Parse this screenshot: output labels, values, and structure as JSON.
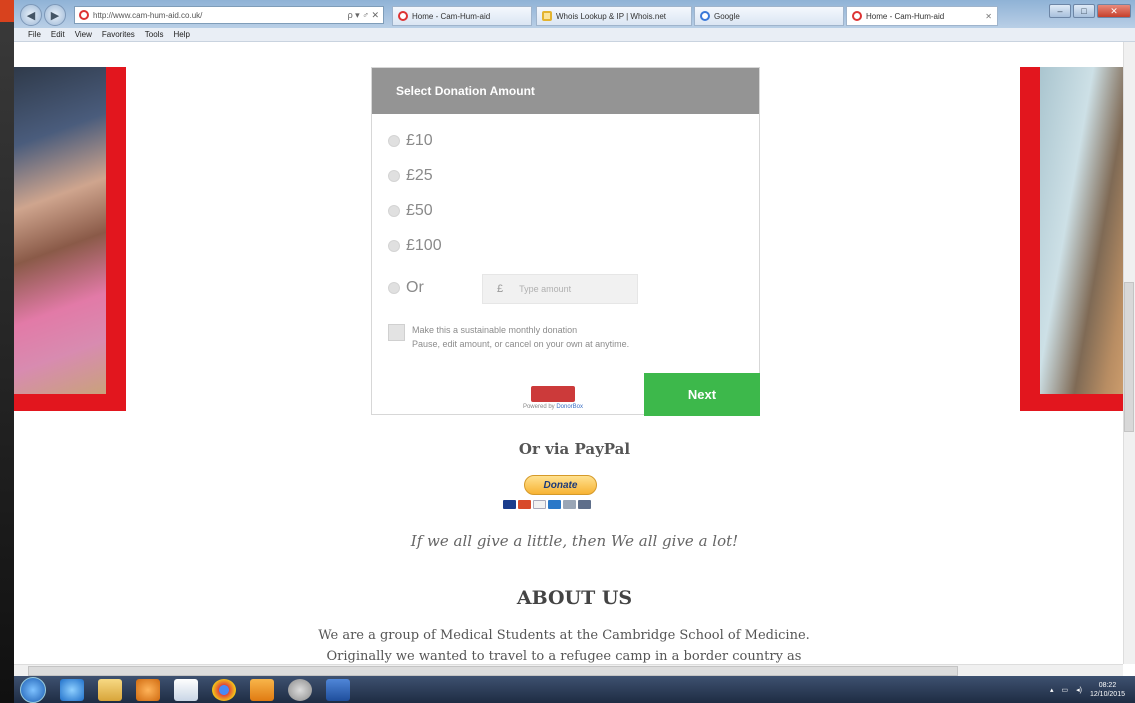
{
  "browser": {
    "address": "http://www.cam-hum-aid.co.uk/",
    "address_controls": "ρ ▾ ♂ ✕",
    "tabs": [
      {
        "label": "Home - Cam-Hum-aid"
      },
      {
        "label": "Whois Lookup & IP | Whois.net"
      },
      {
        "label": "Google"
      },
      {
        "label": "Home - Cam-Hum-aid"
      }
    ],
    "menu": [
      "File",
      "Edit",
      "View",
      "Favorites",
      "Tools",
      "Help"
    ]
  },
  "donation": {
    "header": "Select Donation Amount",
    "amounts": [
      "£10",
      "£25",
      "£50",
      "£100"
    ],
    "or_label": "Or",
    "currency_symbol": "£",
    "custom_placeholder": "Type amount",
    "monthly_line1": "Make this a sustainable monthly donation",
    "monthly_line2": "Pause, edit amount, or cancel on your own at anytime.",
    "powered_by": "Powered by",
    "powered_by_brand": "DonorBox",
    "next_label": "Next"
  },
  "paypal": {
    "title": "Or via PayPal",
    "button_label": "Donate"
  },
  "tagline": "If we all give a little, then We all give a lot!",
  "about": {
    "title": "ABOUT US",
    "line1": "We are a group of Medical Students at the Cambridge School of Medicine.",
    "line2": "Originally we wanted to travel to  a refugee camp in a border country as"
  },
  "taskbar": {
    "time": "08:22",
    "date": "12/10/2015"
  },
  "colors": {
    "accent_red": "#e2161e",
    "next_green": "#3db84b",
    "header_gray": "#949494"
  }
}
